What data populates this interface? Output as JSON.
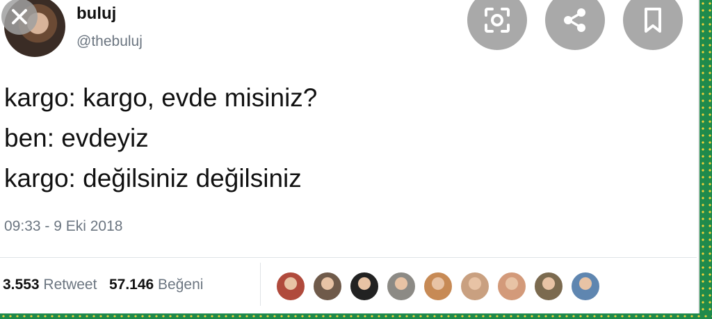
{
  "overlay": {
    "close_icon": "close-icon",
    "actions": [
      {
        "name": "lens-icon"
      },
      {
        "name": "share-icon"
      },
      {
        "name": "bookmark-icon"
      }
    ]
  },
  "tweet": {
    "author_name": "buluj",
    "author_handle": "@thebuluj",
    "lines": [
      "kargo: kargo, evde misiniz?",
      "ben: evdeyiz",
      "kargo: değilsiniz değilsiniz"
    ],
    "timestamp": "09:33 - 9 Eki 2018",
    "retweet_count": "3.553",
    "retweet_label": "Retweet",
    "like_count": "57.146",
    "like_label": "Beğeni"
  },
  "likers": [
    {
      "color": "#b04a3c"
    },
    {
      "color": "#6f5a4a"
    },
    {
      "color": "#222222"
    },
    {
      "color": "#8c8a85"
    },
    {
      "color": "#c78a55"
    },
    {
      "color": "#c9a080"
    },
    {
      "color": "#d39a7a"
    },
    {
      "color": "#7b6a4f"
    },
    {
      "color": "#5f86b0"
    }
  ],
  "colors": {
    "border_green": "#1f8a4c",
    "border_dots": "#f2d23a",
    "overlay_button": "#a9a9a9"
  }
}
